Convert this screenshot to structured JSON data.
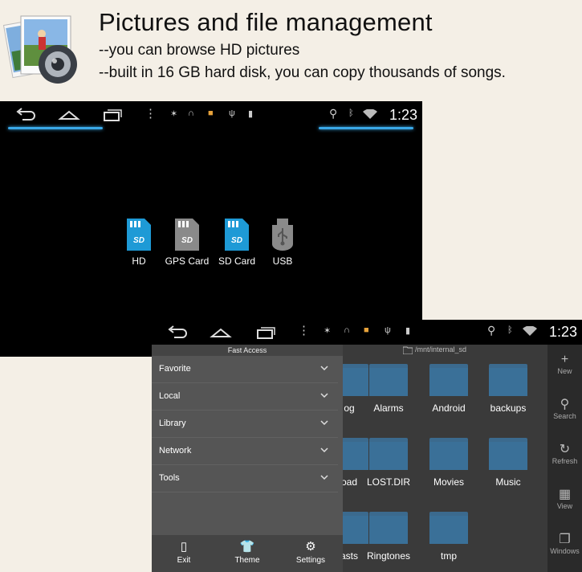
{
  "header": {
    "title": "Pictures and file management",
    "line1": "--you can browse HD pictures",
    "line2": "--built in 16 GB hard disk,  you can copy thousands of songs."
  },
  "statusbar": {
    "time": "1:23"
  },
  "drives": [
    {
      "label": "HD",
      "icon": "sd-card-icon",
      "color": "#1e9ad6"
    },
    {
      "label": "GPS Card",
      "icon": "sd-card-icon",
      "color": "#8a8a8a"
    },
    {
      "label": "SD Card",
      "icon": "sd-card-icon",
      "color": "#1e9ad6"
    },
    {
      "label": "USB",
      "icon": "usb-drive-icon",
      "color": "#8a8a8a"
    }
  ],
  "file_manager": {
    "path": "/mnt/internal_sd",
    "drawer_title": "Fast Access",
    "drawer_items": [
      "Favorite",
      "Local",
      "Library",
      "Network",
      "Tools"
    ],
    "drawer_footer": [
      "Exit",
      "Theme",
      "Settings"
    ],
    "folders": [
      {
        "name": "og"
      },
      {
        "name": "Alarms"
      },
      {
        "name": "Android"
      },
      {
        "name": "backups"
      },
      {
        "name": "oad"
      },
      {
        "name": "LOST.DIR"
      },
      {
        "name": "Movies"
      },
      {
        "name": "Music"
      },
      {
        "name": "asts"
      },
      {
        "name": "Ringtones"
      },
      {
        "name": "tmp"
      }
    ],
    "sidebar": [
      "New",
      "Search",
      "Refresh",
      "View",
      "Windows"
    ]
  },
  "colors": {
    "accent_blue": "#3aa8e8",
    "folder_blue": "#3a7098"
  }
}
